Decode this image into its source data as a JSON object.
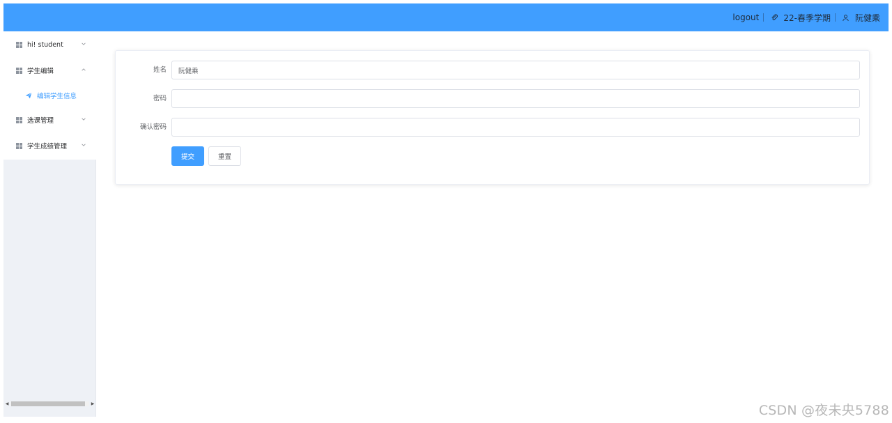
{
  "header": {
    "logout_label": "logout",
    "semester_label": "22-春季学期",
    "user_name": "阮健乘"
  },
  "sidebar": {
    "items": [
      {
        "label": "hi! student",
        "expanded": false
      },
      {
        "label": "学生编辑",
        "expanded": true
      },
      {
        "label": "选课管理",
        "expanded": false
      },
      {
        "label": "学生成绩管理",
        "expanded": false
      }
    ],
    "sub_items": [
      {
        "label": "编辑学生信息",
        "active": true
      }
    ]
  },
  "form": {
    "name_label": "姓名",
    "name_value": "阮健乘",
    "password_label": "密码",
    "password_value": "",
    "confirm_label": "确认密码",
    "confirm_value": "",
    "submit_label": "提交",
    "reset_label": "重置"
  },
  "watermark": "CSDN @夜未央5788",
  "colors": {
    "primary": "#409eff",
    "sidebar_bg": "#eef1f6"
  }
}
